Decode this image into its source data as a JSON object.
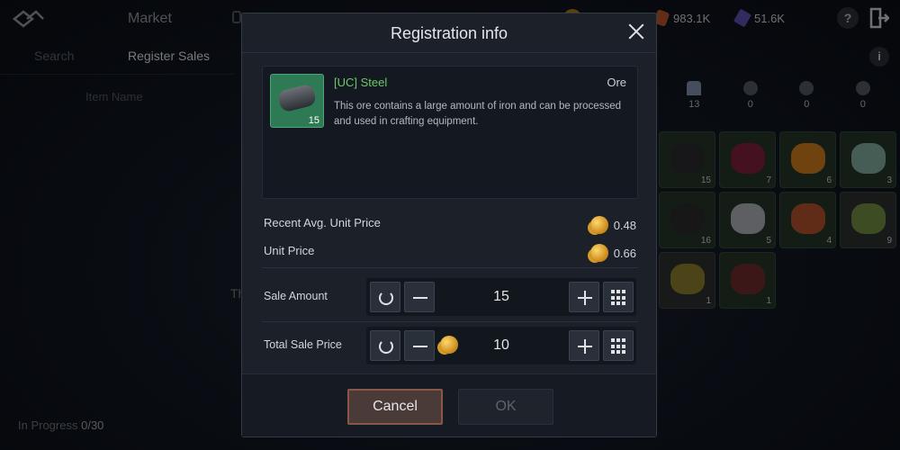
{
  "topbar": {
    "title": "Market",
    "currency_1": "983.1K",
    "currency_2": "51.6K",
    "help": "?"
  },
  "tabs": {
    "search": "Search",
    "register": "Register Sales"
  },
  "left_panel": {
    "item_name_header": "Item Name",
    "partial_text": "Th",
    "in_progress_label": "In Progress",
    "in_progress_count": "0/30"
  },
  "info_button": "i",
  "categories": [
    {
      "icon": "ore-category-icon",
      "count": "13"
    },
    {
      "icon": "gem-category-icon",
      "count": "0"
    },
    {
      "icon": "paw-category-icon",
      "count": "0"
    },
    {
      "icon": "potion-category-icon",
      "count": "0"
    }
  ],
  "inventory": [
    {
      "icon": "steel-ore-icon",
      "count": "15",
      "color": "#2b2b2e",
      "grade": "green"
    },
    {
      "icon": "dark-crystal-icon",
      "count": "7",
      "color": "#7a1f3b",
      "grade": "green"
    },
    {
      "icon": "fire-orb-icon",
      "count": "6",
      "color": "#c97b1d",
      "grade": "green"
    },
    {
      "icon": "spirit-beast-icon",
      "count": "3",
      "color": "#7fa99b",
      "grade": "green"
    },
    {
      "icon": "coal-ore-icon",
      "count": "16",
      "color": "#2a2a2c",
      "grade": "green"
    },
    {
      "icon": "silver-ore-icon",
      "count": "5",
      "color": "#a9aeb4",
      "grade": "green"
    },
    {
      "icon": "copper-orb-icon",
      "count": "4",
      "color": "#b0502b",
      "grade": "green"
    },
    {
      "icon": "herb-icon",
      "count": "9",
      "color": "#6f8a3e",
      "grade": "gray"
    },
    {
      "icon": "gold-ore-icon",
      "count": "1",
      "color": "#8a7a2e",
      "grade": "gray"
    },
    {
      "icon": "cauldron-icon",
      "count": "1",
      "color": "#6e2a2a",
      "grade": "green"
    }
  ],
  "modal": {
    "title": "Registration info",
    "item": {
      "name": "[UC] Steel",
      "type": "Ore",
      "quantity": "15",
      "description": "This ore contains a large amount of iron and can be processed and used in crafting equipment."
    },
    "recent_avg_label": "Recent Avg. Unit Price",
    "recent_avg_value": "0.48",
    "unit_price_label": "Unit Price",
    "unit_price_value": "0.66",
    "sale_amount_label": "Sale Amount",
    "sale_amount_value": "15",
    "total_price_label": "Total Sale Price",
    "total_price_value": "10",
    "cancel_label": "Cancel",
    "ok_label": "OK"
  }
}
